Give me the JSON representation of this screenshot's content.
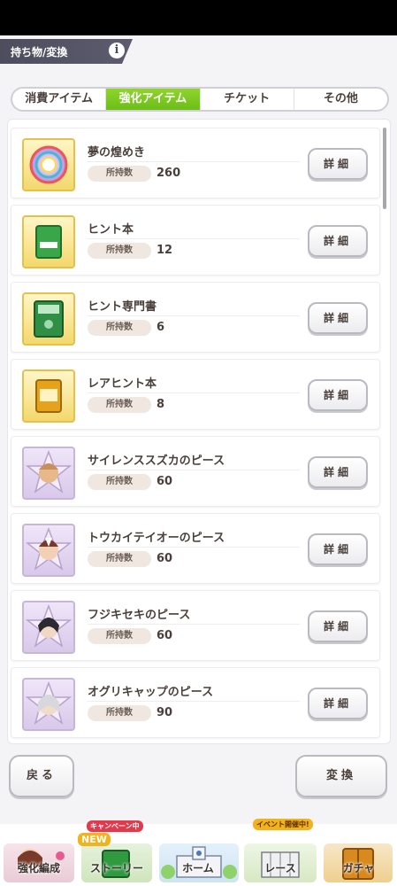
{
  "header": {
    "title": "持ち物/変換",
    "info_icon": "info-icon"
  },
  "tabs": [
    {
      "label": "消費アイテム",
      "active": false
    },
    {
      "label": "強化アイテム",
      "active": true
    },
    {
      "label": "チケット",
      "active": false
    },
    {
      "label": "その他",
      "active": false
    }
  ],
  "items": [
    {
      "name": "夢の煌めき",
      "qty_label": "所持数",
      "qty": "260",
      "detail": "詳細",
      "icon": "rainbow-orb-icon"
    },
    {
      "name": "ヒント本",
      "qty_label": "所持数",
      "qty": "12",
      "detail": "詳細",
      "icon": "green-book-icon"
    },
    {
      "name": "ヒント専門書",
      "qty_label": "所持数",
      "qty": "6",
      "detail": "詳細",
      "icon": "green-tome-icon"
    },
    {
      "name": "レアヒント本",
      "qty_label": "所持数",
      "qty": "8",
      "detail": "詳細",
      "icon": "gold-book-icon"
    },
    {
      "name": "サイレンススズカのピース",
      "qty_label": "所持数",
      "qty": "60",
      "detail": "詳細",
      "icon": "character-piece-icon"
    },
    {
      "name": "トウカイテイオーのピース",
      "qty_label": "所持数",
      "qty": "60",
      "detail": "詳細",
      "icon": "character-piece-icon"
    },
    {
      "name": "フジキセキのピース",
      "qty_label": "所持数",
      "qty": "60",
      "detail": "詳細",
      "icon": "character-piece-icon"
    },
    {
      "name": "オグリキャップのピース",
      "qty_label": "所持数",
      "qty": "90",
      "detail": "詳細",
      "icon": "character-piece-icon"
    }
  ],
  "footer": {
    "back": "戻る",
    "convert": "変換"
  },
  "nav": [
    {
      "label": "強化編成"
    },
    {
      "label": "ストーリー",
      "badge_top": "キャンペーン中",
      "badge_new": "NEW"
    },
    {
      "label": "ホーム"
    },
    {
      "label": "レース",
      "badge_top": "イベント開催中!"
    },
    {
      "label": "ガチャ"
    }
  ],
  "colors": {
    "active_tab": "#7cc81f",
    "badge_red": "#e23a4d",
    "badge_gold": "#f2b21b"
  }
}
